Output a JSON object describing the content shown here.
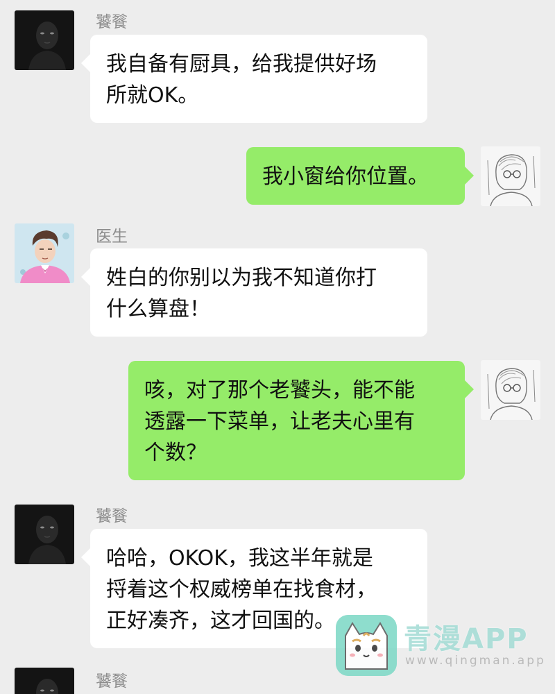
{
  "app": {
    "background_color": "#ededed",
    "sent_bubble_color": "#95ec69",
    "received_bubble_color": "#ffffff"
  },
  "messages": [
    {
      "sender": "饕餮",
      "direction": "received",
      "avatar": "dark-shadow-figure-avatar",
      "text": "我自备有厨具，给我提供好场\n所就OK。"
    },
    {
      "sender": "",
      "direction": "sent",
      "avatar": "sketch-character-avatar",
      "text": "我小窗给你位置。"
    },
    {
      "sender": "医生",
      "direction": "received",
      "avatar": "doctor-pink-suit-avatar",
      "text": "姓白的你别以为我不知道你打\n什么算盘！"
    },
    {
      "sender": "",
      "direction": "sent",
      "avatar": "sketch-character-avatar",
      "text": "咳，对了那个老饕头，能不能\n透露一下菜单，让老夫心里有\n个数？"
    },
    {
      "sender": "饕餮",
      "direction": "received",
      "avatar": "dark-shadow-figure-avatar",
      "text": "哈哈，OKOK，我这半年就是\n捋着这个权威榜单在找食材，\n正好凑齐，这才回国的。"
    },
    {
      "sender": "饕餮",
      "direction": "received",
      "avatar": "dark-shadow-figure-avatar",
      "text": ""
    }
  ],
  "watermark": {
    "title": "青漫APP",
    "url": "www.qingman.app",
    "logo_icon": "cat-logo-icon"
  }
}
